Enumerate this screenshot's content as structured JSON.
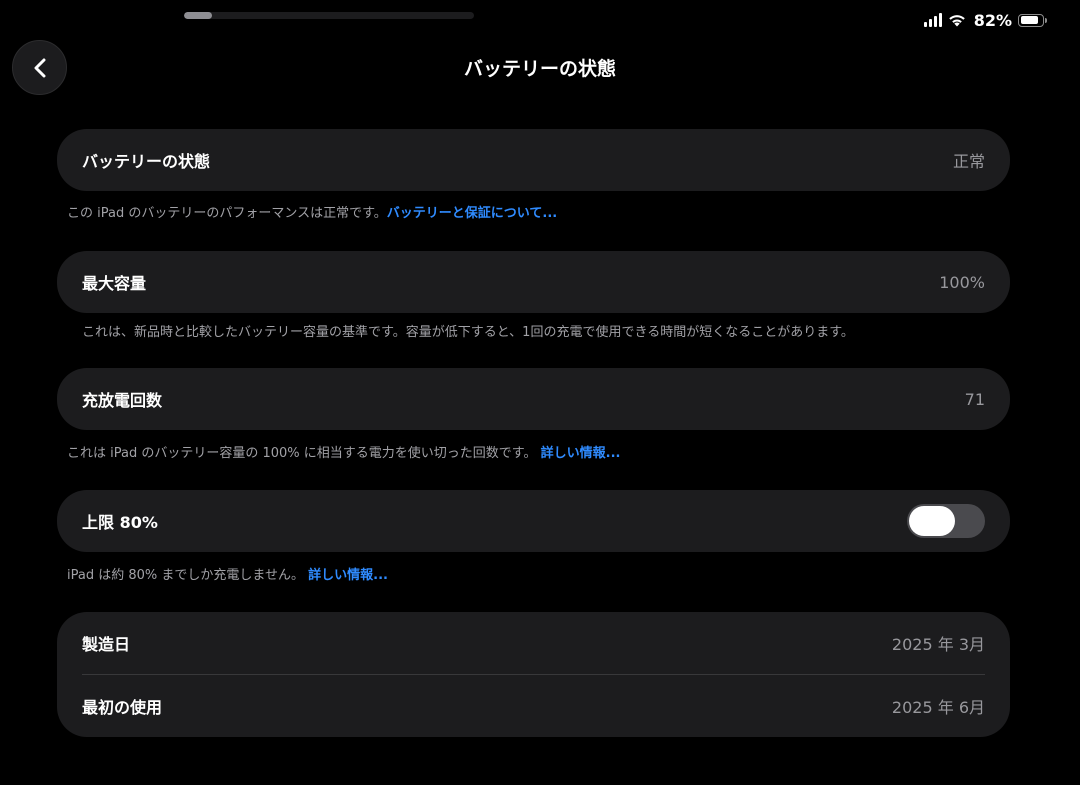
{
  "status_bar": {
    "battery_percent": "82%",
    "battery_level": 0.82
  },
  "header": {
    "title": "バッテリーの状態"
  },
  "battery_health": {
    "label": "バッテリーの状態",
    "value": "正常",
    "note": "この iPad のバッテリーのパフォーマンスは正常です。",
    "link": "バッテリーと保証について..."
  },
  "max_capacity": {
    "label": "最大容量",
    "value": "100%",
    "note": "これは、新品時と比較したバッテリー容量の基準です。容量が低下すると、1回の充電で使用できる時間が短くなることがあります。"
  },
  "cycle_count": {
    "label": "充放電回数",
    "value": "71",
    "note": "これは iPad のバッテリー容量の 100% に相当する電力を使い切った回数です。",
    "link": "詳しい情報..."
  },
  "limit_80": {
    "label": "上限 80%",
    "toggle_on": false,
    "note": "iPad は約 80% までしか充電しません。",
    "link": "詳しい情報..."
  },
  "dates": {
    "manufacture_label": "製造日",
    "manufacture_value": "2025 年 3月",
    "first_use_label": "最初の使用",
    "first_use_value": "2025 年 6月"
  },
  "colors": {
    "background": "#000000",
    "card": "#1c1c1e",
    "link": "#2f8bff",
    "secondary_text": "#98989d"
  },
  "icons": {
    "back": "chevron-left-icon",
    "signal": "cellular-signal-icon",
    "wifi": "wifi-icon",
    "battery": "battery-icon"
  }
}
